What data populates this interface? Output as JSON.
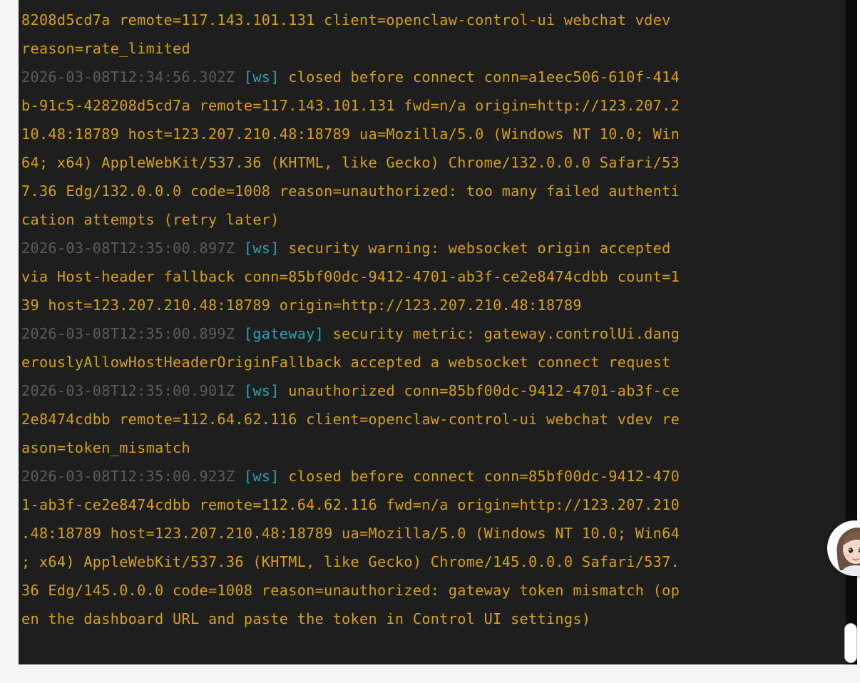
{
  "log": {
    "lines": [
      [
        {
          "t": "msg",
          "text": "8208d5cd7a remote=117.143.101.131 client=openclaw-control-ui webchat vdev"
        }
      ],
      [
        {
          "t": "msg",
          "text": "reason=rate_limited"
        }
      ],
      [
        {
          "t": "ts",
          "text": "2026-03-08T12:34:56.302Z"
        },
        {
          "t": "msg",
          "text": " "
        },
        {
          "t": "tag",
          "text": "[ws]"
        },
        {
          "t": "msg",
          "text": " closed before connect conn=a1eec506-610f-414"
        }
      ],
      [
        {
          "t": "msg",
          "text": "b-91c5-428208d5cd7a remote=117.143.101.131 fwd=n/a origin=http://123.207.2"
        }
      ],
      [
        {
          "t": "msg",
          "text": "10.48:18789 host=123.207.210.48:18789 ua=Mozilla/5.0 (Windows NT 10.0; Win"
        }
      ],
      [
        {
          "t": "msg",
          "text": "64; x64) AppleWebKit/537.36 (KHTML, like Gecko) Chrome/132.0.0.0 Safari/53"
        }
      ],
      [
        {
          "t": "msg",
          "text": "7.36 Edg/132.0.0.0 code=1008 reason=unauthorized: too many failed authenti"
        }
      ],
      [
        {
          "t": "msg",
          "text": "cation attempts (retry later)"
        }
      ],
      [
        {
          "t": "ts",
          "text": "2026-03-08T12:35:00.897Z"
        },
        {
          "t": "msg",
          "text": " "
        },
        {
          "t": "tag",
          "text": "[ws]"
        },
        {
          "t": "msg",
          "text": " security warning: websocket origin accepted"
        }
      ],
      [
        {
          "t": "msg",
          "text": "via Host-header fallback conn=85bf00dc-9412-4701-ab3f-ce2e8474cdbb count=1"
        }
      ],
      [
        {
          "t": "msg",
          "text": "39 host=123.207.210.48:18789 origin=http://123.207.210.48:18789"
        }
      ],
      [
        {
          "t": "ts",
          "text": "2026-03-08T12:35:00.899Z"
        },
        {
          "t": "msg",
          "text": " "
        },
        {
          "t": "tag",
          "text": "[gateway]"
        },
        {
          "t": "msg",
          "text": " security metric: gateway.controlUi.dang"
        }
      ],
      [
        {
          "t": "msg",
          "text": "erouslyAllowHostHeaderOriginFallback accepted a websocket connect request"
        }
      ],
      [
        {
          "t": "ts",
          "text": "2026-03-08T12:35:00.901Z"
        },
        {
          "t": "msg",
          "text": " "
        },
        {
          "t": "tag",
          "text": "[ws]"
        },
        {
          "t": "msg",
          "text": " unauthorized conn=85bf00dc-9412-4701-ab3f-ce"
        }
      ],
      [
        {
          "t": "msg",
          "text": "2e8474cdbb remote=112.64.62.116 client=openclaw-control-ui webchat vdev re"
        }
      ],
      [
        {
          "t": "msg",
          "text": "ason=token_mismatch"
        }
      ],
      [
        {
          "t": "ts",
          "text": "2026-03-08T12:35:00.923Z"
        },
        {
          "t": "msg",
          "text": " "
        },
        {
          "t": "tag",
          "text": "[ws]"
        },
        {
          "t": "msg",
          "text": " closed before connect conn=85bf00dc-9412-470"
        }
      ],
      [
        {
          "t": "msg",
          "text": "1-ab3f-ce2e8474cdbb remote=112.64.62.116 fwd=n/a origin=http://123.207.210"
        }
      ],
      [
        {
          "t": "msg",
          "text": ".48:18789 host=123.207.210.48:18789 ua=Mozilla/5.0 (Windows NT 10.0; Win64"
        }
      ],
      [
        {
          "t": "msg",
          "text": "; x64) AppleWebKit/537.36 (KHTML, like Gecko) Chrome/145.0.0.0 Safari/537."
        }
      ],
      [
        {
          "t": "msg",
          "text": "36 Edg/145.0.0.0 code=1008 reason=unauthorized: gateway token mismatch (op"
        }
      ],
      [
        {
          "t": "msg",
          "text": "en the dashboard URL and paste the token in Control UI settings)"
        }
      ]
    ]
  },
  "colors": {
    "background": "#1e1e1e",
    "message": "#d4a017",
    "timestamp": "#5b5b5b",
    "tag": "#26a5b5",
    "page": "#f5f5f5"
  },
  "icons": {
    "assistant": "assistant-avatar-icon",
    "scrollbar": "scrollbar-thumb"
  }
}
